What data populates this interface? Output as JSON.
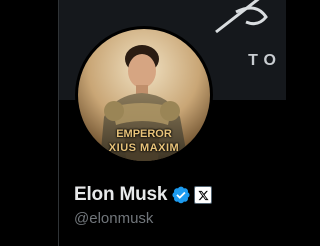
{
  "profile": {
    "display_name": "Elon Musk",
    "handle": "@elonmusk",
    "verified": true,
    "verified_color": "#1d9bf0",
    "affiliate_badge_icon": "x-logo-icon"
  },
  "avatar": {
    "caption_line1": "EMPEROR",
    "caption_line2": "XIUS MAXIM"
  },
  "banner": {
    "text": "TO"
  }
}
